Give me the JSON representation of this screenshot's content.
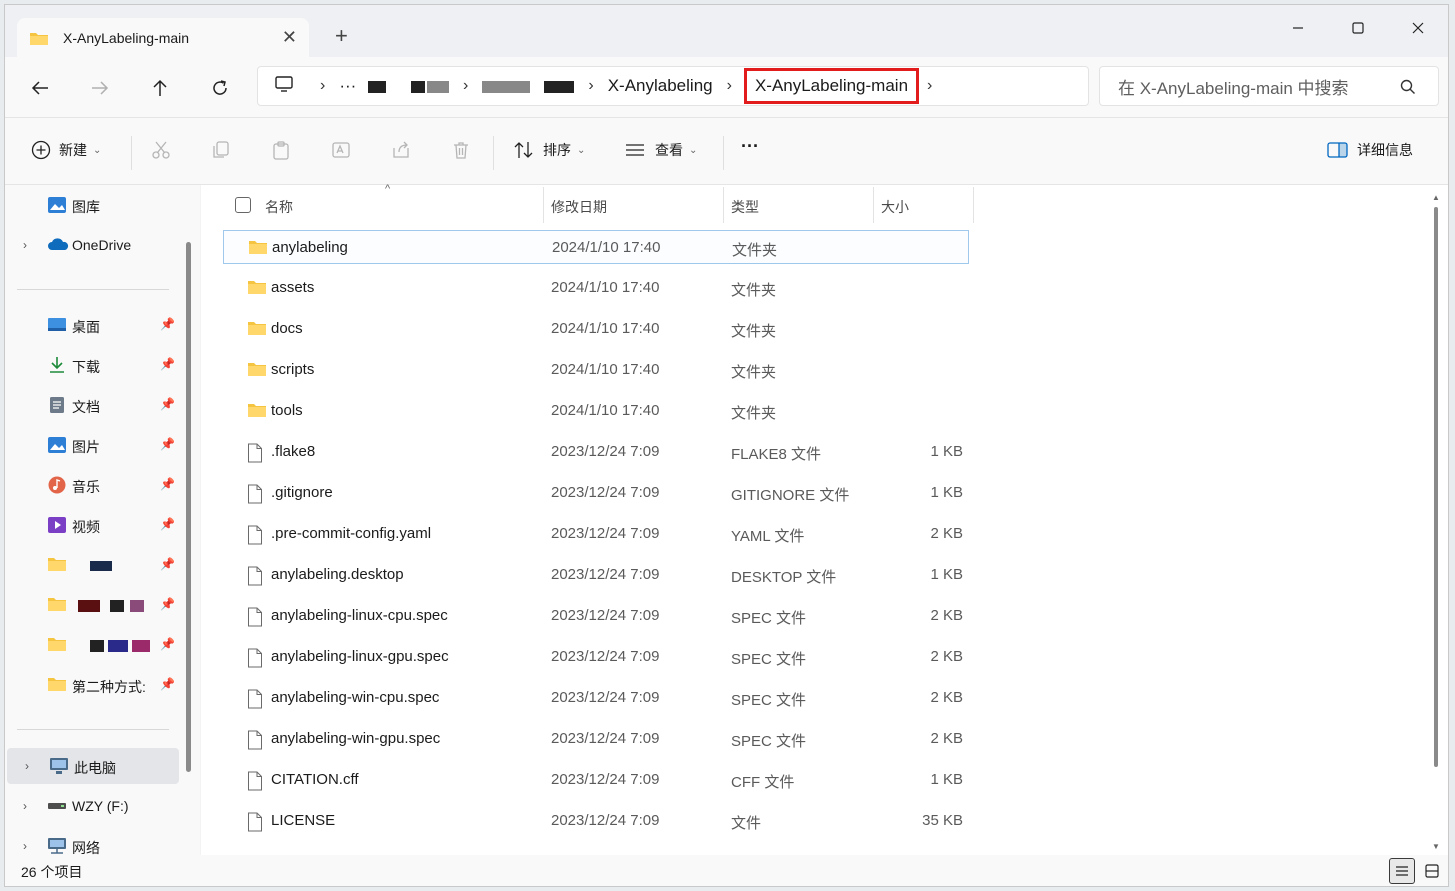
{
  "colors": {
    "accent": "#0067c0",
    "highlight": "#e21c1c",
    "folder": "#f5c542"
  },
  "tab": {
    "title": "X-AnyLabeling-main",
    "icon": "folder-icon"
  },
  "address": {
    "ellipsis": "···",
    "seg1": "X-Anylabeling",
    "current": "X-AnyLabeling-main"
  },
  "search": {
    "placeholder": "在 X-AnyLabeling-main 中搜索"
  },
  "toolbar": {
    "new_label": "新建",
    "sort_label": "排序",
    "view_label": "查看",
    "more_label": "···",
    "details_label": "详细信息"
  },
  "sidebar": {
    "gallery": "图库",
    "onedrive": "OneDrive",
    "desktop": "桌面",
    "downloads": "下载",
    "documents": "文档",
    "pictures": "图片",
    "music": "音乐",
    "videos": "视频",
    "folder_method": "第二种方式:",
    "this_pc": "此电脑",
    "drive": "WZY (F:)",
    "network": "网络"
  },
  "table": {
    "headers": {
      "name": "名称",
      "date": "修改日期",
      "type": "类型",
      "size": "大小"
    },
    "rows": [
      {
        "name": "anylabeling",
        "date": "2024/1/10 17:40",
        "type": "文件夹",
        "size": ""
      },
      {
        "name": "assets",
        "date": "2024/1/10 17:40",
        "type": "文件夹",
        "size": ""
      },
      {
        "name": "docs",
        "date": "2024/1/10 17:40",
        "type": "文件夹",
        "size": ""
      },
      {
        "name": "scripts",
        "date": "2024/1/10 17:40",
        "type": "文件夹",
        "size": ""
      },
      {
        "name": "tools",
        "date": "2024/1/10 17:40",
        "type": "文件夹",
        "size": ""
      },
      {
        "name": ".flake8",
        "date": "2023/12/24 7:09",
        "type": "FLAKE8 文件",
        "size": "1 KB"
      },
      {
        "name": ".gitignore",
        "date": "2023/12/24 7:09",
        "type": "GITIGNORE 文件",
        "size": "1 KB"
      },
      {
        "name": ".pre-commit-config.yaml",
        "date": "2023/12/24 7:09",
        "type": "YAML 文件",
        "size": "2 KB"
      },
      {
        "name": "anylabeling.desktop",
        "date": "2023/12/24 7:09",
        "type": "DESKTOP 文件",
        "size": "1 KB"
      },
      {
        "name": "anylabeling-linux-cpu.spec",
        "date": "2023/12/24 7:09",
        "type": "SPEC 文件",
        "size": "2 KB"
      },
      {
        "name": "anylabeling-linux-gpu.spec",
        "date": "2023/12/24 7:09",
        "type": "SPEC 文件",
        "size": "2 KB"
      },
      {
        "name": "anylabeling-win-cpu.spec",
        "date": "2023/12/24 7:09",
        "type": "SPEC 文件",
        "size": "2 KB"
      },
      {
        "name": "anylabeling-win-gpu.spec",
        "date": "2023/12/24 7:09",
        "type": "SPEC 文件",
        "size": "2 KB"
      },
      {
        "name": "CITATION.cff",
        "date": "2023/12/24 7:09",
        "type": "CFF 文件",
        "size": "1 KB"
      },
      {
        "name": "LICENSE",
        "date": "2023/12/24 7:09",
        "type": "文件",
        "size": "35 KB"
      }
    ]
  },
  "status": {
    "count": "26 个项目"
  }
}
